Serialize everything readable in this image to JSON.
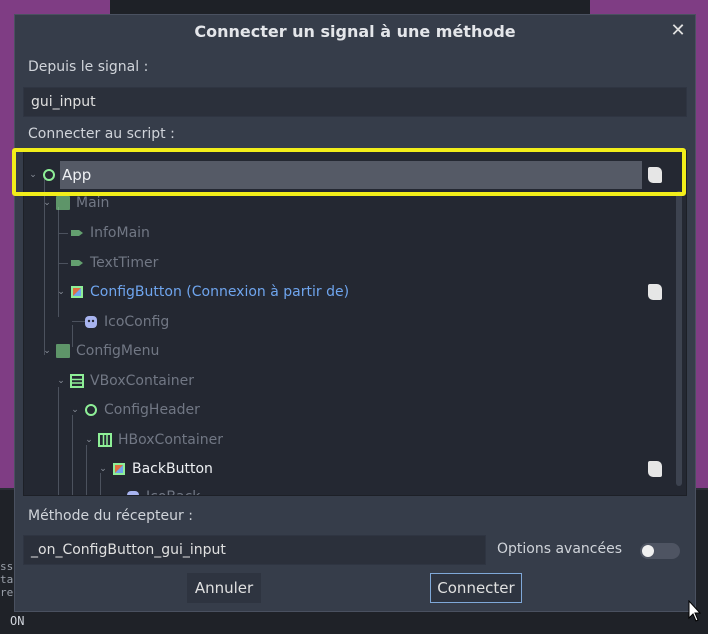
{
  "dialog": {
    "title": "Connecter un signal à une méthode",
    "close_glyph": "✕",
    "from_signal_label": "Depuis le signal :",
    "signal_value": "gui_input",
    "connect_to_script_label": "Connecter au script :",
    "receiver_method_label": "Méthode du récepteur :",
    "receiver_method_value": "_on_ConfigButton_gui_input",
    "advanced_options_label": "Options avancées",
    "advanced_options_on": false,
    "cancel_label": "Annuler",
    "connect_label": "Connecter"
  },
  "tree": {
    "items": [
      {
        "label": "App",
        "icon": "node2d-circle-icon",
        "has_script": true,
        "selected": true
      },
      {
        "label": "Main",
        "icon": "control-icon",
        "has_script": false
      },
      {
        "label": "InfoMain",
        "icon": "label-icon",
        "has_script": false
      },
      {
        "label": "TextTimer",
        "icon": "label-icon",
        "has_script": false
      },
      {
        "label": "ConfigButton (Connexion à partir de)",
        "icon": "texture-button-icon",
        "has_script": true
      },
      {
        "label": "IcoConfig",
        "icon": "sprite-icon",
        "has_script": false
      },
      {
        "label": "ConfigMenu",
        "icon": "control-icon",
        "has_script": false
      },
      {
        "label": "VBoxContainer",
        "icon": "vbox-icon",
        "has_script": false
      },
      {
        "label": "ConfigHeader",
        "icon": "circle-icon",
        "has_script": false
      },
      {
        "label": "HBoxContainer",
        "icon": "hbox-icon",
        "has_script": false
      },
      {
        "label": "BackButton",
        "icon": "texture-button-icon",
        "has_script": true
      },
      {
        "label": "IcoBack",
        "icon": "sprite-icon",
        "has_script": false
      }
    ]
  },
  "background": {
    "console_lines": [
      "ss",
      "ta",
      "re"
    ],
    "status": "ON"
  },
  "colors": {
    "highlight": "#f2ee1a",
    "node_green": "#8eef97",
    "link_blue": "#6fa5ee",
    "dialog_bg": "#363d4a"
  }
}
